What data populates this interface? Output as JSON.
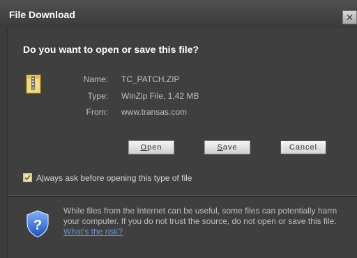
{
  "window": {
    "title": "File Download",
    "close_symbol": "✕"
  },
  "dialog": {
    "question": "Do you want to open or save this file?",
    "icon": "zip-file-icon",
    "fields": {
      "name_label": "Name:",
      "name_value": "TC_PATCH.ZIP",
      "type_label": "Type:",
      "type_value": "WinZip File, 1,42 MB",
      "from_label": "From:",
      "from_value": "www.transas.com"
    },
    "buttons": {
      "open": {
        "pre": "",
        "mnemonic": "O",
        "post": "pen"
      },
      "save": {
        "pre": "",
        "mnemonic": "S",
        "post": "ave"
      },
      "cancel": "Cancel"
    },
    "checkbox": {
      "checked": true,
      "label_pre": "A",
      "label_mnemonic": "l",
      "label_post": "ways ask before opening this type of file"
    },
    "warning": {
      "icon": "shield-question-icon",
      "text": "While files from the Internet can be useful, some files can potentially harm your computer. If you do not trust the source, do not open or save this file.",
      "link": "What's the risk?"
    }
  },
  "colors": {
    "background": "#3f3f3f",
    "titlebar": "#3a3a3a",
    "link": "#6f93c7",
    "checkbox": "#f2e6a6"
  }
}
